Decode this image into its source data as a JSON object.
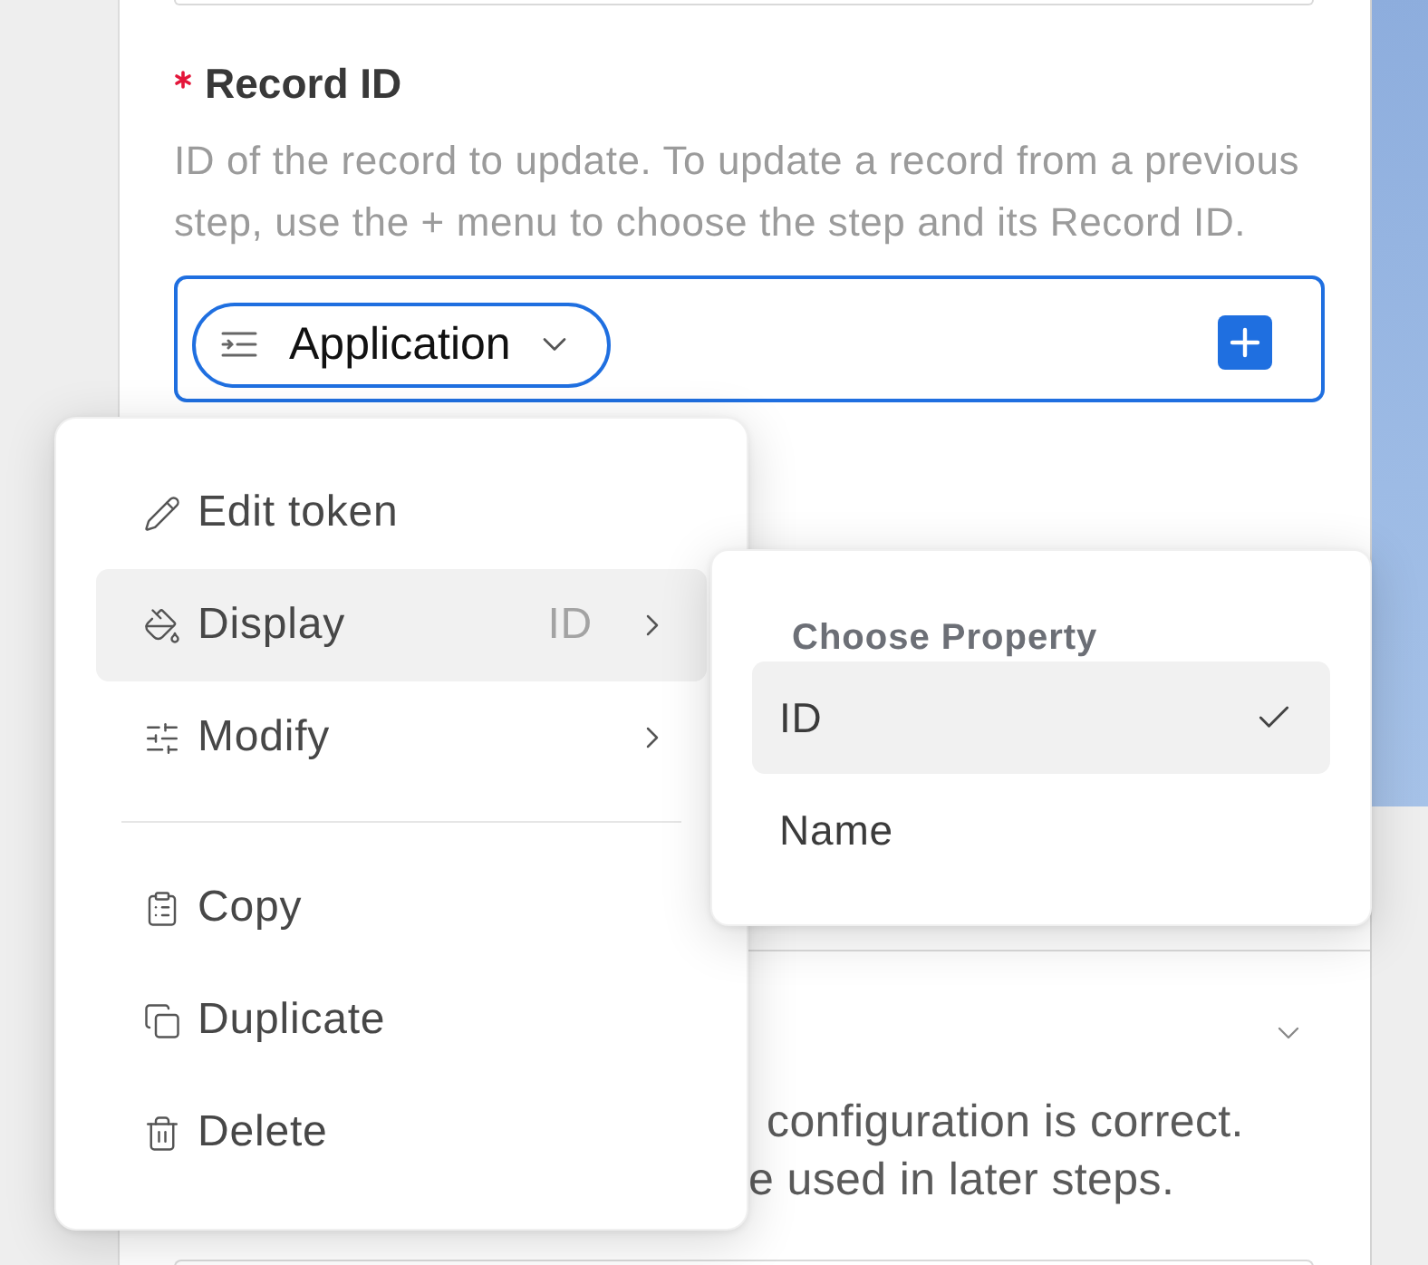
{
  "field": {
    "label": "Record ID",
    "required": true,
    "description": "ID of the record to update. To update a record from a previous step, use the + menu to choose the step and its Record ID.",
    "focused": true,
    "token": {
      "label": "Application"
    }
  },
  "section": {
    "text_lines": [
      "configuration is correct.",
      "e used in later steps."
    ]
  },
  "context_menu": {
    "groups": [
      {
        "items": [
          {
            "label": "Edit token",
            "has_submenu": false,
            "selected": false
          },
          {
            "label": "Display",
            "value": "ID",
            "has_submenu": true,
            "selected": true
          },
          {
            "label": "Modify",
            "has_submenu": true,
            "selected": false
          }
        ]
      },
      {
        "items": [
          {
            "label": "Copy",
            "has_submenu": false,
            "selected": false
          },
          {
            "label": "Duplicate",
            "has_submenu": false,
            "selected": false
          },
          {
            "label": "Delete",
            "has_submenu": false,
            "selected": false
          }
        ]
      }
    ]
  },
  "submenu": {
    "title": "Choose Property",
    "options": [
      {
        "label": "ID",
        "selected": true
      },
      {
        "label": "Name",
        "selected": false
      }
    ]
  }
}
